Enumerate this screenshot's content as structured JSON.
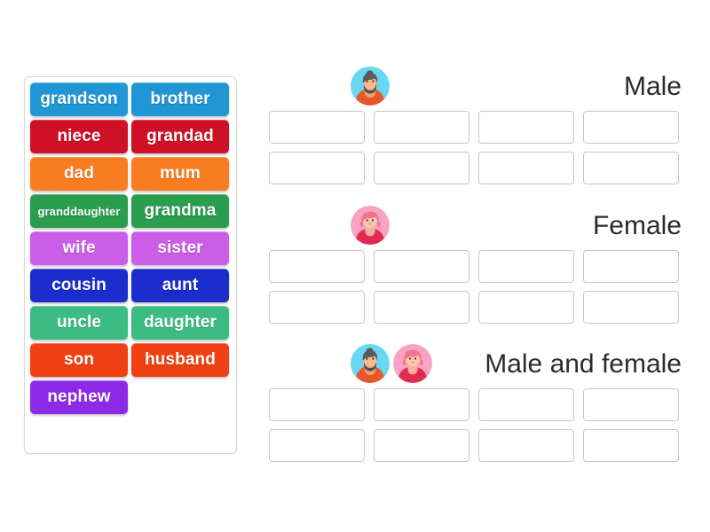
{
  "word_bank": {
    "name": "word-bank",
    "tiles": [
      {
        "label": "grandson",
        "color": "#2196d4",
        "small": false
      },
      {
        "label": "brother",
        "color": "#2196d4",
        "small": false
      },
      {
        "label": "niece",
        "color": "#ce1126",
        "small": false
      },
      {
        "label": "grandad",
        "color": "#ce1126",
        "small": false
      },
      {
        "label": "dad",
        "color": "#f97d20",
        "small": false
      },
      {
        "label": "mum",
        "color": "#f97d20",
        "small": false
      },
      {
        "label": "granddaughter",
        "color": "#2a9d4e",
        "small": true
      },
      {
        "label": "grandma",
        "color": "#2a9d4e",
        "small": false
      },
      {
        "label": "wife",
        "color": "#cc5de8",
        "small": false
      },
      {
        "label": "sister",
        "color": "#cc5de8",
        "small": false
      },
      {
        "label": "cousin",
        "color": "#1b2dcc",
        "small": false
      },
      {
        "label": "aunt",
        "color": "#1b2dcc",
        "small": false
      },
      {
        "label": "uncle",
        "color": "#3cbc83",
        "small": false
      },
      {
        "label": "daughter",
        "color": "#3cbc83",
        "small": false
      },
      {
        "label": "son",
        "color": "#f04011",
        "small": false
      },
      {
        "label": "husband",
        "color": "#f04011",
        "small": false
      },
      {
        "label": "nephew",
        "color": "#8d2ae8",
        "small": false
      }
    ]
  },
  "categories": [
    {
      "id": "male",
      "label": "Male",
      "avatars": [
        "male-avatar"
      ],
      "slot_rows": [
        [
          "",
          "",
          "",
          ""
        ],
        [
          "",
          "",
          "",
          ""
        ]
      ]
    },
    {
      "id": "female",
      "label": "Female",
      "avatars": [
        "female-avatar"
      ],
      "slot_rows": [
        [
          "",
          "",
          "",
          ""
        ],
        [
          "",
          "",
          "",
          ""
        ]
      ]
    },
    {
      "id": "both",
      "label": "Male and female",
      "avatars": [
        "male-avatar",
        "female-avatar"
      ],
      "slot_rows": [
        [
          "",
          "",
          "",
          ""
        ],
        [
          "",
          "",
          "",
          ""
        ]
      ]
    }
  ],
  "palette": {
    "page_background": "#ffffff",
    "panel_border": "#d8d8d8",
    "slot_border": "#c6c6c6",
    "label_text": "#2b2b2b"
  }
}
